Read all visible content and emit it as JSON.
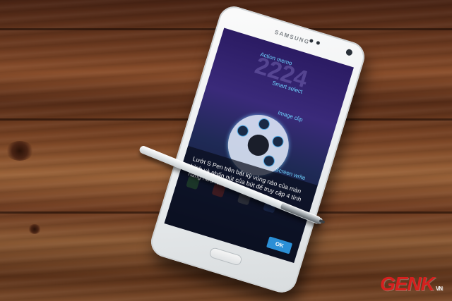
{
  "scene": {
    "description_free": true
  },
  "phone": {
    "brand": "SAMSUNG",
    "clock_time": "2224",
    "air_command": {
      "items": [
        {
          "label": "Action memo",
          "icon": "memo-icon"
        },
        {
          "label": "Smart select",
          "icon": "smart-select-icon"
        },
        {
          "label": "Image clip",
          "icon": "image-clip-icon"
        },
        {
          "label": "Screen write",
          "icon": "screen-write-icon"
        }
      ]
    },
    "tip_text": "Lướt S Pen trên bất kỳ vùng nào của màn hình và nhấn nút của bút để truy cập 4 tính năng hữu ích của bút.",
    "ok_label": "OK"
  },
  "watermark": {
    "text": "GENK",
    "suffix": "VN",
    "color": "#d6201e"
  },
  "colors": {
    "accent": "#6fd3ff",
    "ok_button": "#2b8fd6"
  }
}
